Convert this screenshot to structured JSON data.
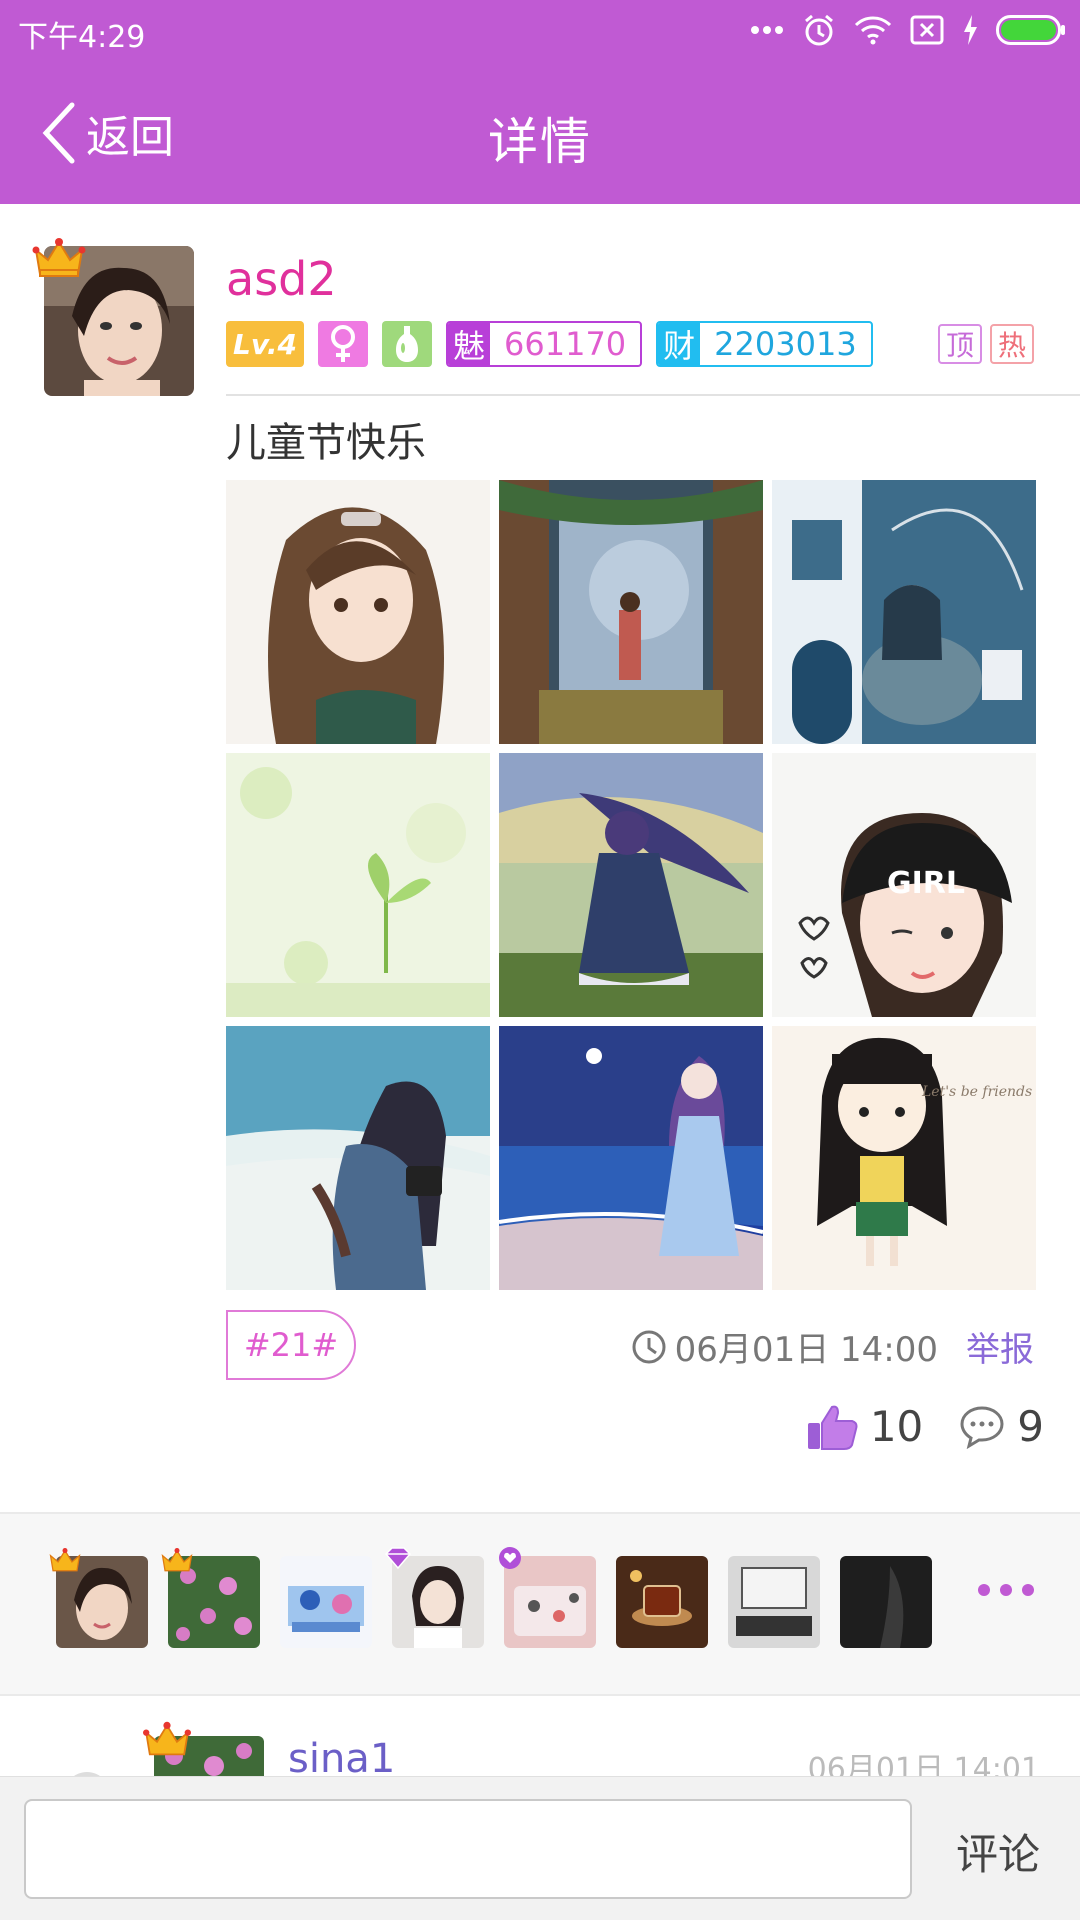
{
  "status_bar": {
    "time": "下午4:29"
  },
  "nav": {
    "back_label": "返回",
    "title": "详情"
  },
  "post": {
    "username": "asd2",
    "level": "Lv.4",
    "charm_char": "魅",
    "charm_value": "661170",
    "wealth_char": "财",
    "wealth_value": "2203013",
    "tag_top": "顶",
    "tag_hot": "热",
    "text": "儿童节快乐",
    "topic": "#21#",
    "time": "06月01日 14:00",
    "report": "举报",
    "likes": "10",
    "comments": "9"
  },
  "comment": {
    "username": "sina1",
    "time": "06月01日 14:01"
  },
  "input": {
    "placeholder": "",
    "submit": "评论"
  },
  "colors": {
    "brand": "#c05ad3",
    "username": "#e0309c",
    "charm": "#b83fd8",
    "wealth": "#21bdf0"
  }
}
